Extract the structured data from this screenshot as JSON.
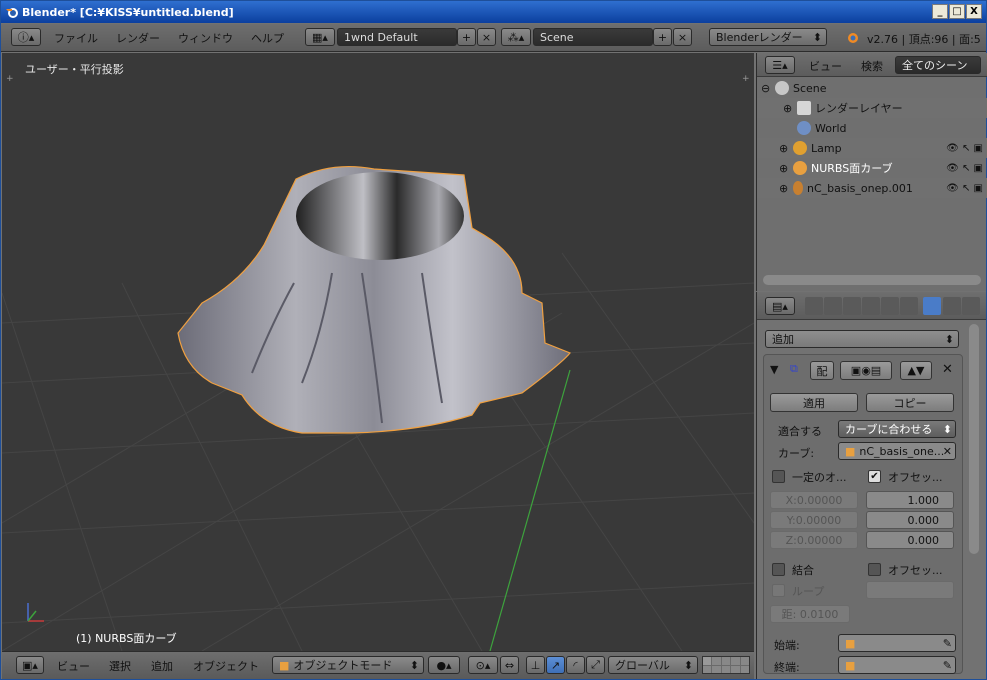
{
  "window": {
    "title": "Blender* [C:¥KISS¥untitled.blend]",
    "controls": [
      "_",
      "□",
      "X"
    ]
  },
  "topbar": {
    "menus": [
      "ファイル",
      "レンダー",
      "ウィンドウ",
      "ヘルプ"
    ],
    "layout": "1wnd Default",
    "scene": "Scene",
    "engine": "Blenderレンダー",
    "stats": "v2.76 | 頂点:96 | 面:5"
  },
  "viewport": {
    "view_label": "ユーザー・平行投影",
    "object_label": "(1) NURBS面カーブ"
  },
  "viewport_header": {
    "menus": [
      "ビュー",
      "選択",
      "追加",
      "オブジェクト"
    ],
    "mode": "オブジェクトモード",
    "orientation": "グローバル"
  },
  "outliner": {
    "tabs": [
      "ビュー",
      "検索",
      "全てのシーン"
    ],
    "rows": [
      {
        "label": "Scene"
      },
      {
        "label": "レンダーレイヤー"
      },
      {
        "label": "World"
      },
      {
        "label": "Lamp"
      },
      {
        "label": "NURBS面カーブ"
      },
      {
        "label": "nC_basis_onep.001"
      }
    ]
  },
  "properties": {
    "add_modifier": "追加",
    "modifier_name": "配",
    "apply": "適用",
    "copy": "コピー",
    "fit_label": "適合する",
    "fit_value": "カーブに合わせる",
    "curve_label": "カーブ:",
    "curve_value": "nC_basis_one...",
    "constant_label": "一定のオ...",
    "offset_label": "オフセッ...",
    "x_value": "X:0.00000",
    "y_value": "Y:0.00000",
    "z_value": "Z:0.00000",
    "offset_x": "1.000",
    "offset_y": "0.000",
    "offset_z": "0.000",
    "merge_label": "結合",
    "offset2_label": "オフセッ...",
    "loop_label": "ループ",
    "distance": "距: 0.0100",
    "start_label": "始端:",
    "end_label": "終端:"
  },
  "colors": {
    "selection_outline": "#f0a040",
    "viewport_bg": "#393939",
    "header_bg": "#5c5c5c",
    "axis_green": "#3da33d"
  }
}
